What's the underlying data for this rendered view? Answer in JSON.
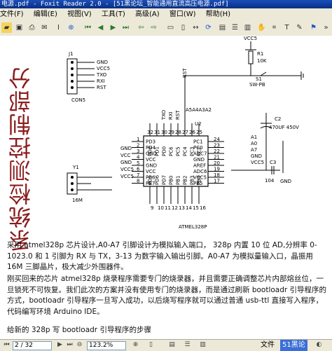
{
  "window": {
    "title": "电源.pdf - Foxit Reader 2.0 - [51黑论坛_智能通用直流高压电源.pdf]"
  },
  "menu": [
    "文件(F)",
    "编辑(E)",
    "视图(V)",
    "工具(T)",
    "高级(A)",
    "窗口(W)",
    "帮助(H)"
  ],
  "toolbar_icons": [
    "open-icon",
    "save-icon",
    "print-icon",
    "email-icon",
    "hand-icon",
    "select-text-icon",
    "zoom-in-icon",
    "first-page-icon",
    "prev-page-icon",
    "next-page-icon",
    "last-page-icon",
    "back-icon",
    "forward-icon",
    "actual-size-icon",
    "fit-page-icon",
    "fit-width-icon",
    "rotate-icon",
    "single-page-icon",
    "continuous-icon",
    "facing-icon",
    "hand-tool-icon",
    "snapshot-icon",
    "text-tool-icon",
    "bookmark-icon"
  ],
  "schematic": {
    "vertical_title": "系统检测控制部分",
    "con5": {
      "ref": "J1",
      "name": "CON5",
      "pins": [
        "GND",
        "VCC5",
        "TXO",
        "RXI",
        "RST"
      ]
    },
    "y1": {
      "ref": "Y1",
      "name": "16M"
    },
    "reset": {
      "r": "R1",
      "rval": "10K",
      "sw": "S1",
      "swname": "SW-PB",
      "net": "RST",
      "vcc": "VCC5"
    },
    "cap": {
      "ref": "C2",
      "val": "470UF 450V",
      "c3": "C3",
      "c3val": "104",
      "gnd": "GND"
    },
    "chip": {
      "ref": "U2",
      "name": "ATMEL328P",
      "left_pins": [
        "PD3",
        "PD4",
        "GND",
        "VCC",
        "GND",
        "VCC",
        "PB6",
        "PB7"
      ],
      "left_nums": [
        "1",
        "2",
        "3",
        "4",
        "5",
        "6",
        "7",
        "8"
      ],
      "right_pins": [
        "PC1",
        "PC0",
        "ADC7",
        "GND",
        "AREF",
        "ADC6",
        "VCC5",
        "PB5"
      ],
      "right_nums": [
        "24",
        "23",
        "22",
        "21",
        "20",
        "19",
        "18",
        "17"
      ],
      "top_pins": [
        "PD2",
        "PD1",
        "PD0",
        "PC6",
        "PC5",
        "PC4",
        "PC3",
        "PC2"
      ],
      "top_nums": [
        "32",
        "31",
        "30",
        "29",
        "28",
        "27",
        "26",
        "25"
      ],
      "bottom_pins": [
        "PD5",
        "PD6",
        "PD7",
        "PB0",
        "PB1",
        "PB2",
        "PB3",
        "PB4"
      ],
      "bottom_nums": [
        "9",
        "10",
        "11",
        "12",
        "13",
        "14",
        "15",
        "16"
      ],
      "left_nets": [
        "GND",
        "VCC",
        "GND",
        "VCC5",
        "VCC5"
      ],
      "right_nets": [
        "A1",
        "A0",
        "A7",
        "GND",
        "VCC5"
      ],
      "top_nets": [
        "TXO",
        "RXI",
        "RST"
      ],
      "top_bus": "A5A4A3A2"
    }
  },
  "paragraphs": [
    "采用 atmel328p 芯片设计,A0-A7 引脚设计为模拟输入端口， 328p 内置 10 位 AD,分辨率 0-1023.0 和 1 引脚为 RX 与 TX，3-13 为数字输入输出引脚。A0-A7 为模拟量输入口，晶振用 16M 三脚晶片，极大减少外围器件。",
    "刚买回来的芯片 atmel328p 烧录程序需要专门的烧录器，并且需要正确调整芯片内部熔丝位，一旦锁死不可恢复。我们此次的方案并没有使用专门的烧录器，而是通过刷新 bootloadr 引导程序的方式，bootloadr 引导程序一旦写入成功，以后烧写程序就可以通过普通 usb-ttl 直接写入程序，代码编写环境 Arduino IDE。",
    "给新的 328p 写 bootloadr 引导程序的步骤"
  ],
  "status": {
    "page": "2 / 32",
    "zoom": "123.2%",
    "task": "文件",
    "taskbar_item": "51黑论"
  }
}
